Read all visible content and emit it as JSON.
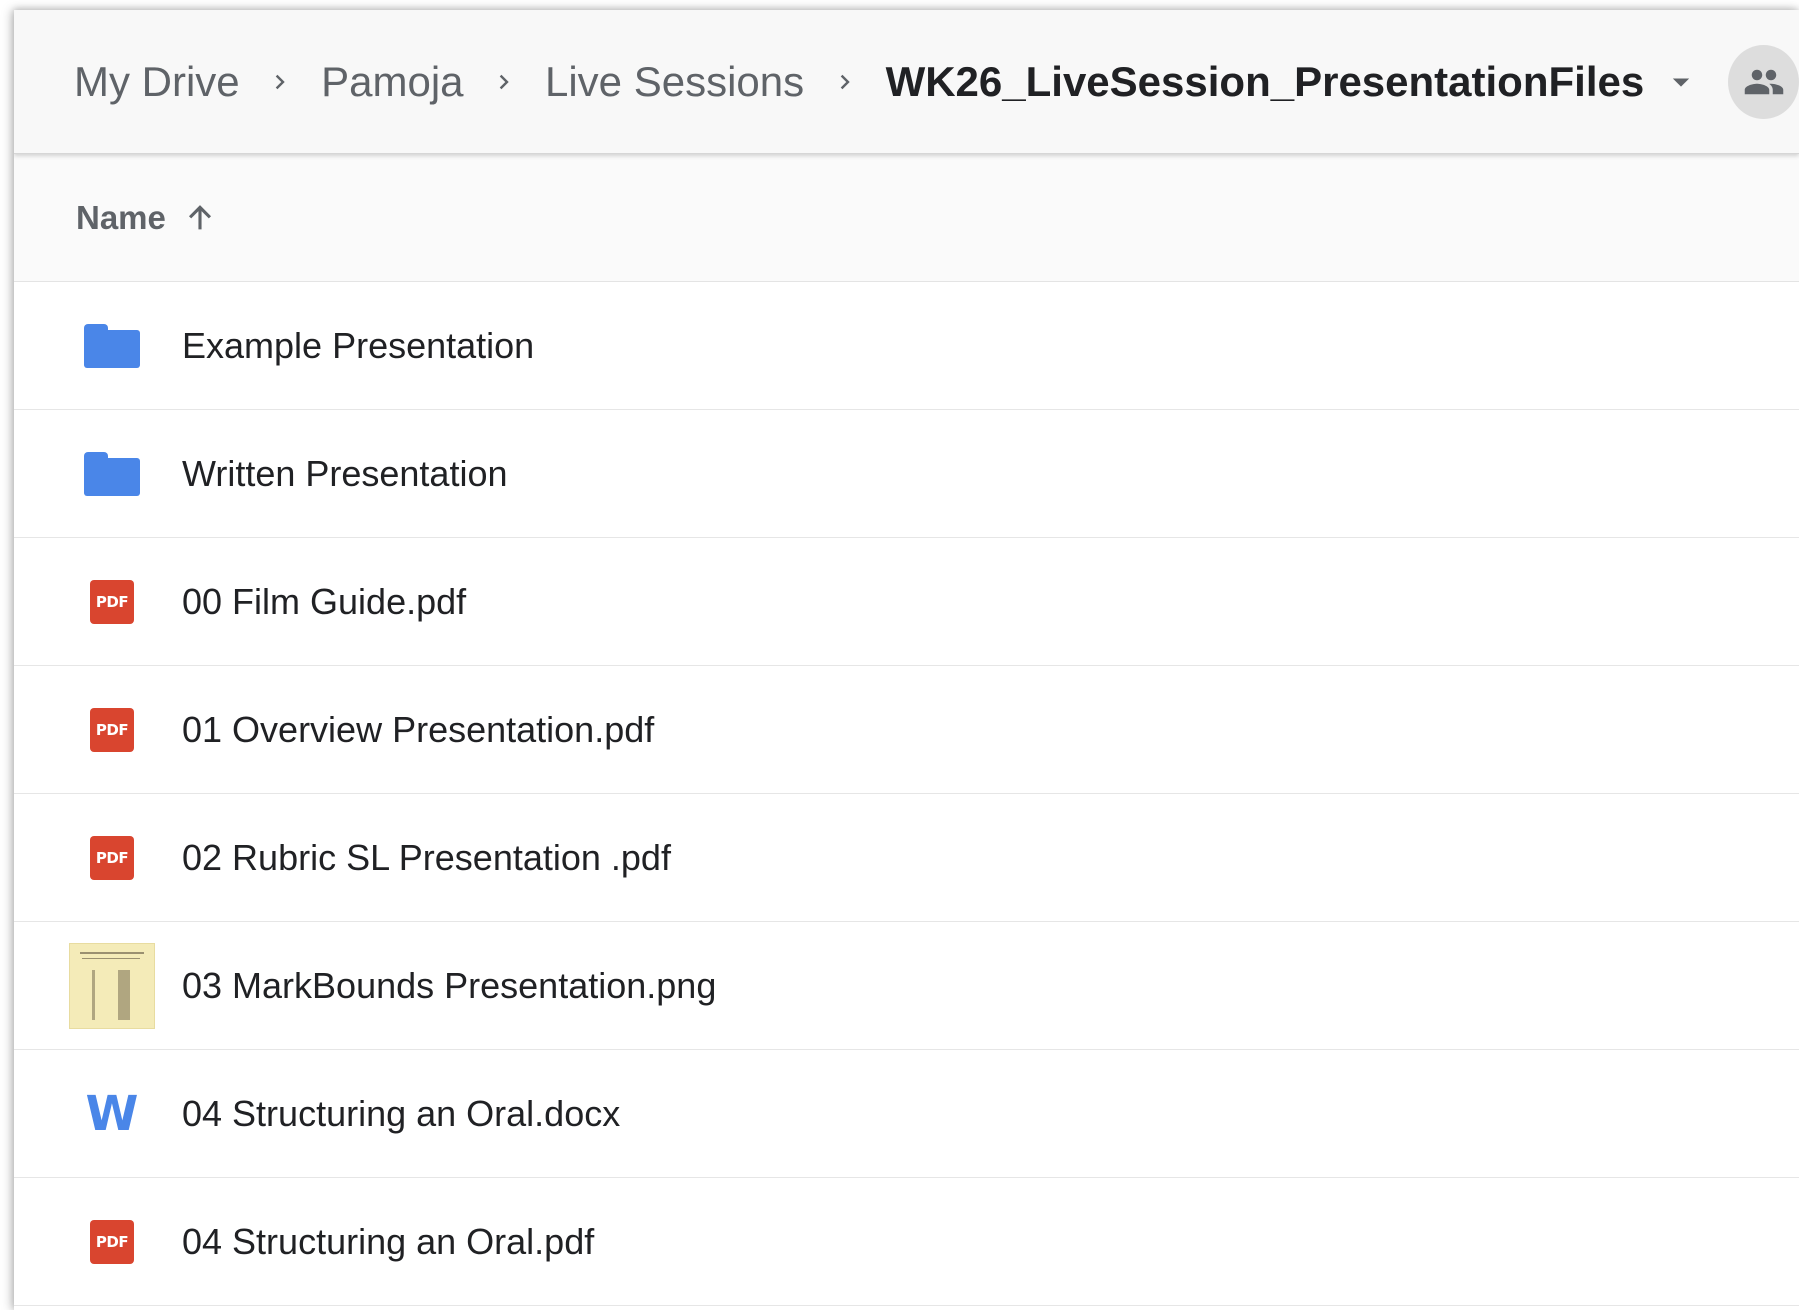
{
  "breadcrumb": {
    "items": [
      {
        "label": "My Drive"
      },
      {
        "label": "Pamoja"
      },
      {
        "label": "Live Sessions"
      },
      {
        "label": "WK26_LiveSession_PresentationFiles"
      }
    ]
  },
  "icons": {
    "separator": "chevron-right-icon",
    "dropdown": "caret-down-icon",
    "share": "people-icon",
    "sort": "arrow-up-icon"
  },
  "list": {
    "column_header": "Name",
    "sort_direction": "ascending",
    "files": [
      {
        "name": "Example Presentation",
        "type": "folder"
      },
      {
        "name": "Written Presentation",
        "type": "folder"
      },
      {
        "name": "00 Film Guide.pdf",
        "type": "pdf"
      },
      {
        "name": "01 Overview Presentation.pdf",
        "type": "pdf"
      },
      {
        "name": "02 Rubric SL Presentation .pdf",
        "type": "pdf"
      },
      {
        "name": "03 MarkBounds Presentation.png",
        "type": "image"
      },
      {
        "name": "04 Structuring an Oral.docx",
        "type": "word"
      },
      {
        "name": "04 Structuring an Oral.pdf",
        "type": "pdf"
      }
    ]
  },
  "file_icon_glyphs": {
    "pdf": "PDF",
    "word": "W"
  },
  "colors": {
    "folder": "#4a86e8",
    "pdf": "#d9452f",
    "word": "#4a86e8",
    "image_thumb": "#f4ebb8"
  }
}
